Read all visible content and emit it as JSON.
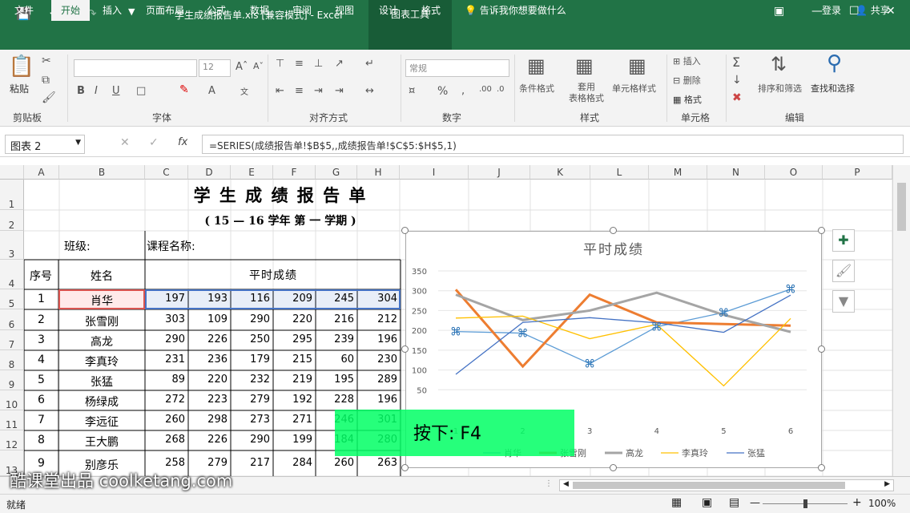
{
  "window": {
    "doc_title": "学生成绩报告单.xls  [兼容模式] - Excel",
    "contextual_tab": "图表工具"
  },
  "tabs": [
    "文件",
    "开始",
    "插入",
    "页面布局",
    "公式",
    "数据",
    "审阅",
    "视图",
    "设计",
    "格式"
  ],
  "tell_me": "告诉我你想要做什么",
  "login": "登录",
  "share": "共享",
  "ribbon": {
    "groups": [
      "剪贴板",
      "字体",
      "对齐方式",
      "数字",
      "样式",
      "单元格",
      "编辑"
    ],
    "paste": "粘贴",
    "font_size": "12",
    "number_format": "常规",
    "styles": [
      "条件格式",
      "套用\n表格格式",
      "单元格样式"
    ],
    "cells": [
      "插入",
      "删除",
      "格式"
    ],
    "edit": [
      "排序和筛选",
      "查找和选择"
    ]
  },
  "formula_bar": {
    "name_box": "图表 2",
    "fx": "fx",
    "formula": "=SERIES(成绩报告单!$B$5,,成绩报告单!$C$5:$H$5,1)"
  },
  "columns": [
    "A",
    "B",
    "C",
    "D",
    "E",
    "F",
    "G",
    "H",
    "I",
    "J",
    "K",
    "L",
    "M",
    "N",
    "O",
    "P"
  ],
  "rows": [
    "1",
    "2",
    "3",
    "4",
    "5",
    "6",
    "7",
    "8",
    "9",
    "10",
    "11",
    "12",
    "13"
  ],
  "sheet": {
    "title": "学 生 成 绩 报 告 单",
    "subtitle": "( 15 — 16    学年 第 一 学期 )",
    "class_label": "班级:",
    "course_label": "课程名称:",
    "col_seq": "序号",
    "col_name": "姓名",
    "col_scores": "平时成绩",
    "students": [
      {
        "seq": "1",
        "name": "肖华",
        "scores": [
          "197",
          "193",
          "116",
          "209",
          "245",
          "304"
        ]
      },
      {
        "seq": "2",
        "name": "张雪刚",
        "scores": [
          "303",
          "109",
          "290",
          "220",
          "216",
          "212"
        ]
      },
      {
        "seq": "3",
        "name": "高龙",
        "scores": [
          "290",
          "226",
          "250",
          "295",
          "239",
          "196"
        ]
      },
      {
        "seq": "4",
        "name": "李真玲",
        "scores": [
          "231",
          "236",
          "179",
          "215",
          "60",
          "230"
        ]
      },
      {
        "seq": "5",
        "name": "张猛",
        "scores": [
          "89",
          "220",
          "232",
          "219",
          "195",
          "289"
        ]
      },
      {
        "seq": "6",
        "name": "杨绿成",
        "scores": [
          "272",
          "223",
          "279",
          "192",
          "228",
          "196"
        ]
      },
      {
        "seq": "7",
        "name": "李远征",
        "scores": [
          "260",
          "298",
          "273",
          "271",
          "246",
          "301"
        ]
      },
      {
        "seq": "8",
        "name": "王大鹏",
        "scores": [
          "268",
          "226",
          "290",
          "199",
          "184",
          "280"
        ]
      },
      {
        "seq": "9",
        "name": "别彦乐",
        "scores": [
          "258",
          "279",
          "217",
          "284",
          "260",
          "263"
        ]
      }
    ]
  },
  "chart_data": {
    "type": "line",
    "title": "平时成绩",
    "x": [
      1,
      2,
      3,
      4,
      5,
      6
    ],
    "ylim": [
      0,
      350
    ],
    "yticks": [
      "350",
      "300",
      "250",
      "200",
      "150",
      "100",
      "50"
    ],
    "series": [
      {
        "name": "肖华",
        "values": [
          197,
          193,
          116,
          209,
          245,
          304
        ],
        "color": "#5b9bd5"
      },
      {
        "name": "张雪刚",
        "values": [
          303,
          109,
          290,
          220,
          216,
          212
        ],
        "color": "#ed7d31"
      },
      {
        "name": "高龙",
        "values": [
          290,
          226,
          250,
          295,
          239,
          196
        ],
        "color": "#a5a5a5"
      },
      {
        "name": "李真玲",
        "values": [
          231,
          236,
          179,
          215,
          60,
          230
        ],
        "color": "#ffc000"
      },
      {
        "name": "张猛",
        "values": [
          89,
          220,
          232,
          219,
          195,
          289
        ],
        "color": "#4472c4"
      }
    ]
  },
  "overlay": {
    "key_hint": "按下:  F4",
    "watermark": "酷课堂出品 coolketang.com"
  },
  "status": {
    "ready": "就绪",
    "zoom": "100%"
  }
}
